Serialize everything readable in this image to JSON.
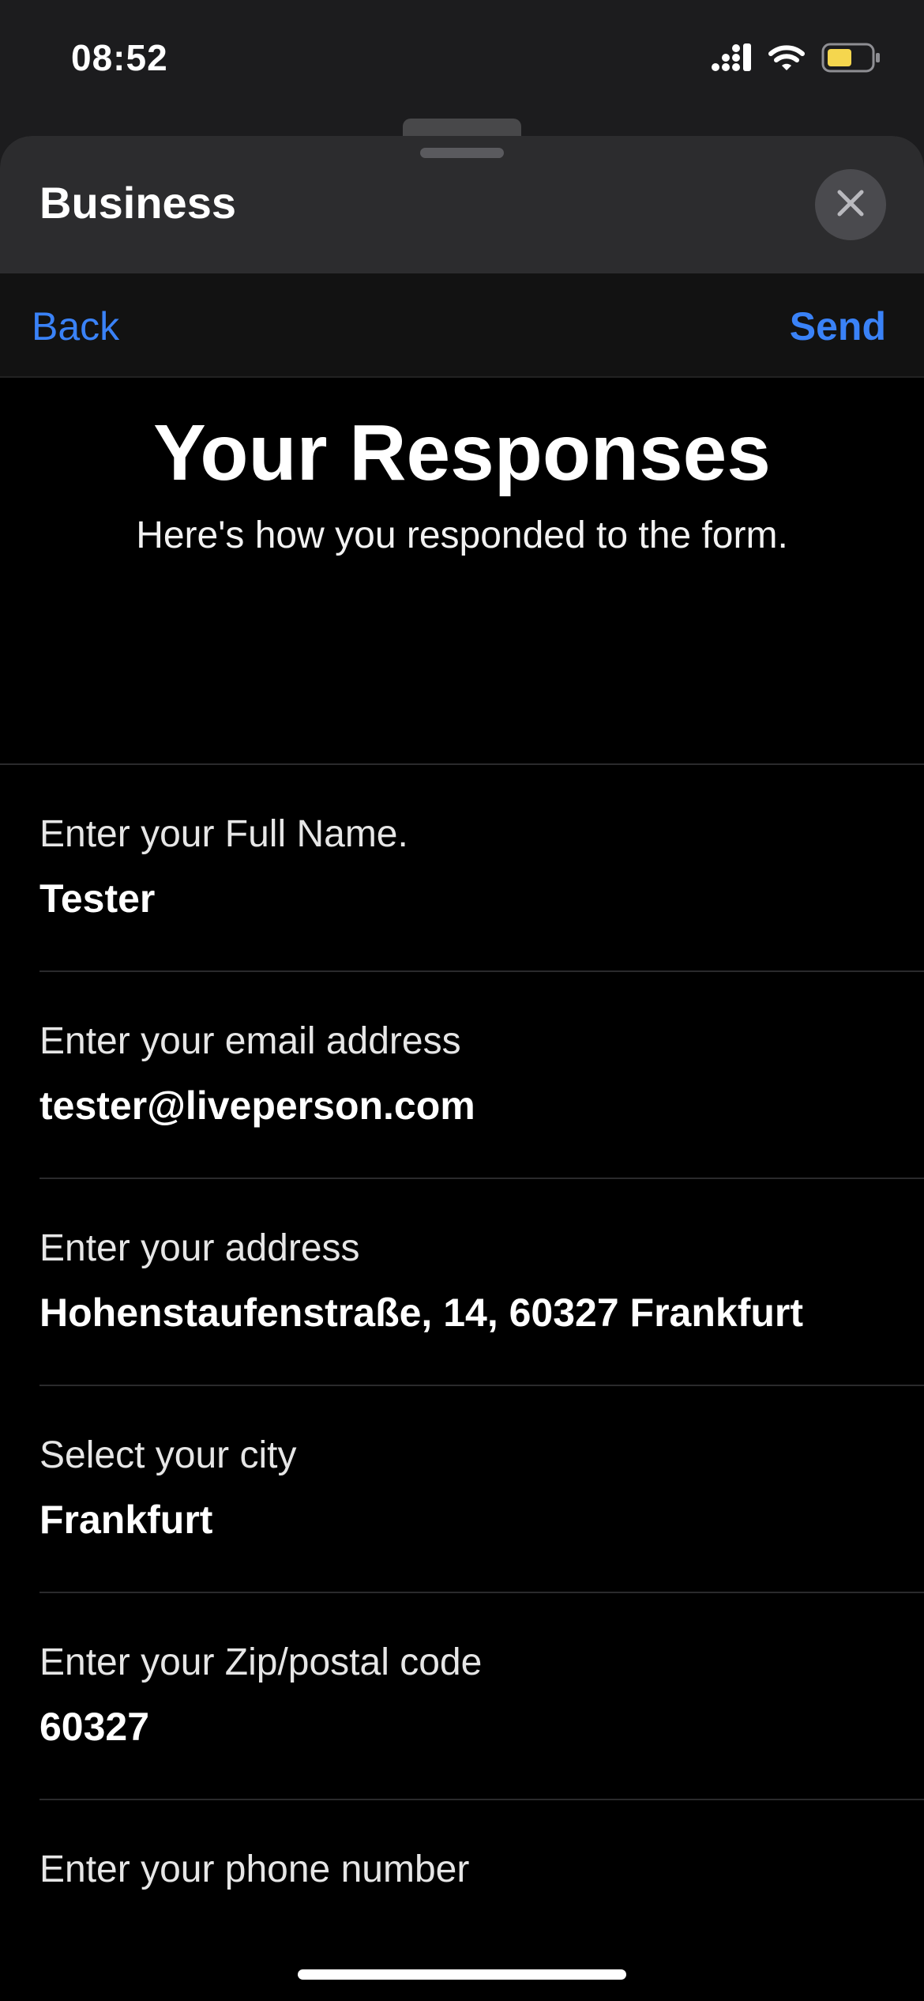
{
  "status_bar": {
    "time": "08:52",
    "icons": [
      "cellular-signal-icon",
      "wifi-icon",
      "battery-icon"
    ],
    "battery_color": "#f5d64e"
  },
  "sheet": {
    "title": "Business",
    "close_icon": "close-icon"
  },
  "nav": {
    "back_label": "Back",
    "send_label": "Send",
    "accent_color": "#3a82f7"
  },
  "hero": {
    "title": "Your Responses",
    "subtitle": "Here's how you responded to the form."
  },
  "responses": [
    {
      "label": "Enter your Full Name.",
      "value": "Tester"
    },
    {
      "label": "Enter your email address",
      "value": "tester@liveperson.com"
    },
    {
      "label": "Enter your address",
      "value": "Hohenstaufenstraße, 14, 60327 Frankfurt"
    },
    {
      "label": "Select your city",
      "value": "Frankfurt"
    },
    {
      "label": "Enter your Zip/postal code",
      "value": "60327"
    },
    {
      "label": "Enter your phone number",
      "value": ""
    }
  ]
}
